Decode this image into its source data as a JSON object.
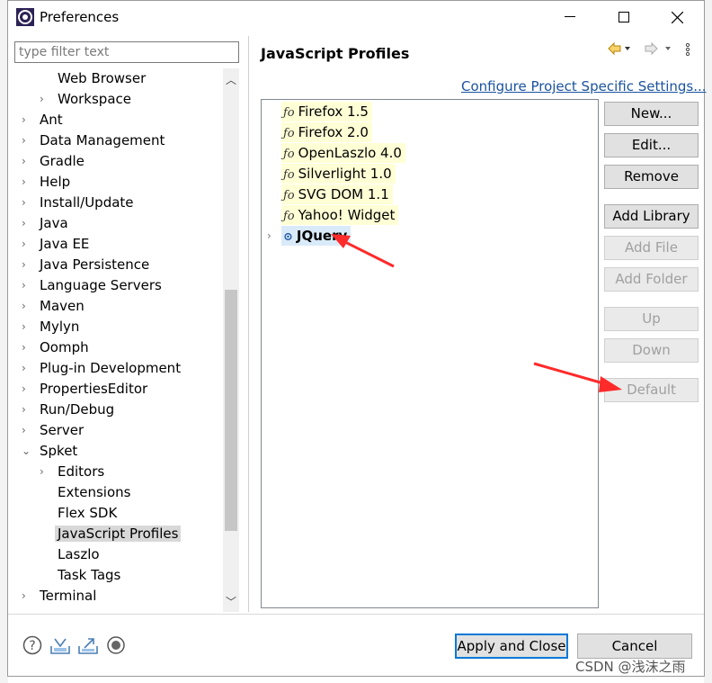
{
  "window": {
    "title": "Preferences"
  },
  "filter": {
    "placeholder": "type filter text"
  },
  "tree": {
    "items": [
      {
        "label": "Web Browser",
        "level": 1,
        "expander": ""
      },
      {
        "label": "Workspace",
        "level": 1,
        "expander": "›"
      },
      {
        "label": "Ant",
        "level": 0,
        "expander": "›"
      },
      {
        "label": "Data Management",
        "level": 0,
        "expander": "›"
      },
      {
        "label": "Gradle",
        "level": 0,
        "expander": "›"
      },
      {
        "label": "Help",
        "level": 0,
        "expander": "›"
      },
      {
        "label": "Install/Update",
        "level": 0,
        "expander": "›"
      },
      {
        "label": "Java",
        "level": 0,
        "expander": "›"
      },
      {
        "label": "Java EE",
        "level": 0,
        "expander": "›"
      },
      {
        "label": "Java Persistence",
        "level": 0,
        "expander": "›"
      },
      {
        "label": "Language Servers",
        "level": 0,
        "expander": "›"
      },
      {
        "label": "Maven",
        "level": 0,
        "expander": "›"
      },
      {
        "label": "Mylyn",
        "level": 0,
        "expander": "›"
      },
      {
        "label": "Oomph",
        "level": 0,
        "expander": "›"
      },
      {
        "label": "Plug-in Development",
        "level": 0,
        "expander": "›"
      },
      {
        "label": "PropertiesEditor",
        "level": 0,
        "expander": "›"
      },
      {
        "label": "Run/Debug",
        "level": 0,
        "expander": "›"
      },
      {
        "label": "Server",
        "level": 0,
        "expander": "›"
      },
      {
        "label": "Spket",
        "level": 0,
        "expander": "⌄"
      },
      {
        "label": "Editors",
        "level": 1,
        "expander": "›"
      },
      {
        "label": "Extensions",
        "level": 1,
        "expander": ""
      },
      {
        "label": "Flex SDK",
        "level": 1,
        "expander": ""
      },
      {
        "label": "JavaScript Profiles",
        "level": 1,
        "expander": "",
        "selected": true
      },
      {
        "label": "Laszlo",
        "level": 1,
        "expander": ""
      },
      {
        "label": "Task Tags",
        "level": 1,
        "expander": ""
      },
      {
        "label": "Terminal",
        "level": 0,
        "expander": "›"
      }
    ]
  },
  "pane": {
    "title": "JavaScript Profiles",
    "configure_link": "Configure Project Specific Settings..."
  },
  "profiles": [
    {
      "label": "Firefox 1.5",
      "glyph": "ƒo"
    },
    {
      "label": "Firefox 2.0",
      "glyph": "ƒo"
    },
    {
      "label": "OpenLaszlo 4.0",
      "glyph": "ƒo"
    },
    {
      "label": "Silverlight 1.0",
      "glyph": "ƒo"
    },
    {
      "label": "SVG DOM 1.1",
      "glyph": "ƒo"
    },
    {
      "label": "Yahoo! Widget",
      "glyph": "ƒo"
    },
    {
      "label": "JQuery",
      "glyph": "⊙",
      "selected": true
    }
  ],
  "buttons": {
    "new": "New...",
    "edit": "Edit...",
    "remove": "Remove",
    "add_library": "Add Library",
    "add_file": "Add File",
    "add_folder": "Add Folder",
    "up": "Up",
    "down": "Down",
    "default": "Default",
    "apply_close": "Apply and Close",
    "cancel": "Cancel"
  },
  "watermark": "CSDN @浅沫之雨",
  "colors": {
    "accent": "#0078d7",
    "link": "#1a53a0",
    "highlight": "#ffffd6",
    "arrow": "#ff2a2a"
  },
  "icons": [
    "help-icon",
    "import-icon",
    "export-icon",
    "record-icon",
    "back-arrow-icon",
    "forward-arrow-icon",
    "view-menu-icon"
  ]
}
